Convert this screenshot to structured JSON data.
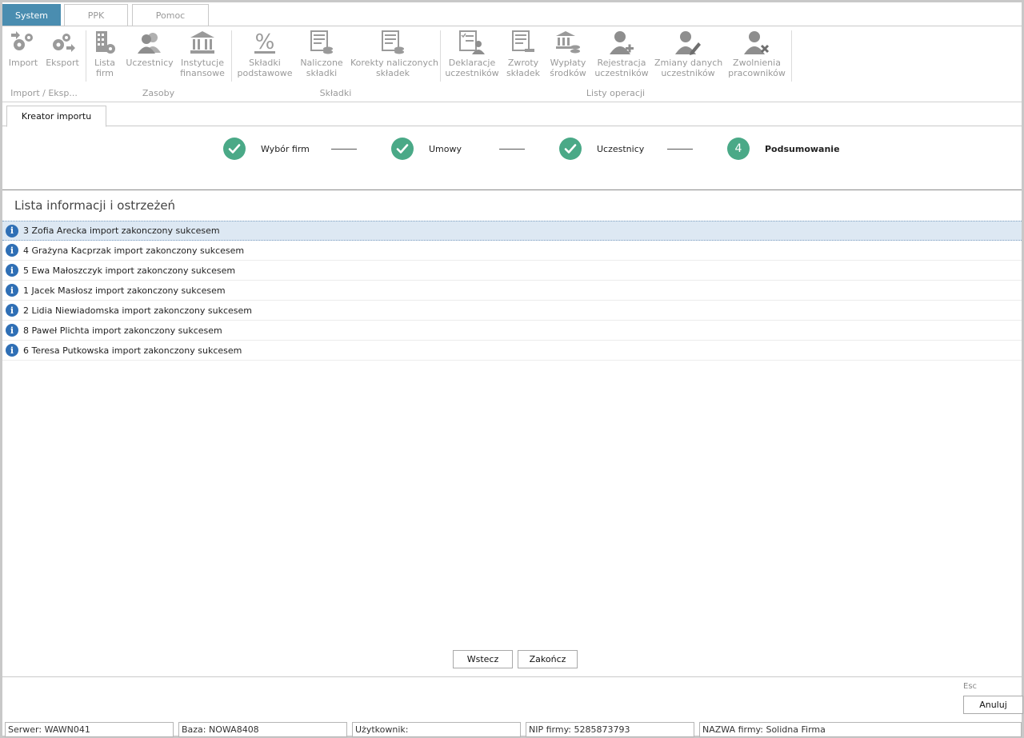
{
  "menu": {
    "tabs": [
      {
        "label": "System",
        "active": true
      },
      {
        "label": "PPK",
        "active": false
      },
      {
        "label": "Pomoc",
        "active": false
      }
    ]
  },
  "ribbon": {
    "buttons": {
      "import": [
        "Import",
        ""
      ],
      "eksport": [
        "Eksport",
        ""
      ],
      "lista_firm": [
        "Lista",
        "firm"
      ],
      "uczestnicy": [
        "Uczestnicy",
        ""
      ],
      "instytucje": [
        "Instytucje",
        "finansowe"
      ],
      "skladki_podstawowe": [
        "Składki",
        "podstawowe"
      ],
      "naliczone_skladki": [
        "Naliczone",
        "składki"
      ],
      "korekty": [
        "Korekty naliczonych",
        "składek"
      ],
      "deklaracje": [
        "Deklaracje",
        "uczestników"
      ],
      "zwroty": [
        "Zwroty",
        "składek"
      ],
      "wyplaty": [
        "Wypłaty",
        "środków"
      ],
      "rejestracja": [
        "Rejestracja",
        "uczestników"
      ],
      "zmiany": [
        "Zmiany danych",
        "uczestników"
      ],
      "zwolnienia": [
        "Zwolnienia",
        "pracowników"
      ]
    },
    "groups": {
      "import_eksport": "Import / Eksp...",
      "zasoby": "Zasoby",
      "skladki": "Składki",
      "listy_operacji": "Listy operacji"
    }
  },
  "document_tab": "Kreator importu",
  "stepper": {
    "steps": [
      {
        "label": "Wybór firm",
        "status": "done"
      },
      {
        "label": "Umowy",
        "status": "done"
      },
      {
        "label": "Uczestnicy",
        "status": "done"
      },
      {
        "label": "Podsumowanie",
        "status": "current",
        "number": "4"
      }
    ]
  },
  "section_title": "Lista informacji i ostrzeżeń",
  "messages": [
    "3 Zofia Arecka import zakonczony sukcesem",
    "4 Grażyna Kacprzak import zakonczony sukcesem",
    "5 Ewa Małoszczyk import zakonczony sukcesem",
    "1 Jacek Masłosz import zakonczony sukcesem",
    "2 Lidia Niewiadomska import zakonczony sukcesem",
    "8 Paweł Plichta import zakonczony sukcesem",
    "6 Teresa Putkowska import zakonczony sukcesem"
  ],
  "buttons": {
    "back": "Wstecz",
    "finish": "Zakończ",
    "cancel": "Anuluj",
    "esc_hint": "Esc"
  },
  "status_bar": {
    "server": "Serwer: WAWN041",
    "database": "Baza: NOWA8408",
    "user": "Użytkownik:",
    "nip": "NIP firmy: 5285873793",
    "company": "NAZWA firmy: Solidna Firma"
  },
  "colors": {
    "active_menu": "#4a8db0",
    "step_green": "#4aa987",
    "info_blue": "#2f6fb5",
    "selected_row": "#dde8f3"
  }
}
